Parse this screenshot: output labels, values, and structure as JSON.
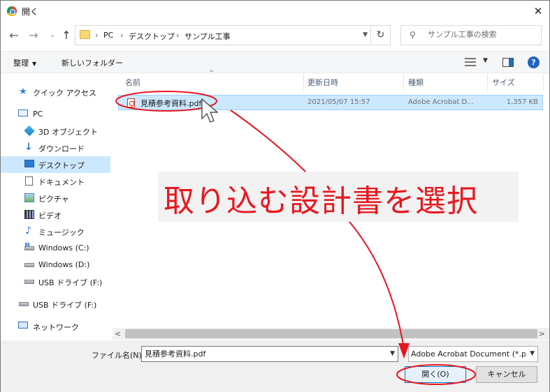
{
  "window": {
    "title": "開く",
    "close_symbol": "✕"
  },
  "nav": {
    "back_symbol": "←",
    "forward_symbol": "→",
    "dropdown_symbol": "⌄",
    "up_symbol": "↑",
    "breadcrumb": [
      "PC",
      "デスクトップ",
      "サンプル工事"
    ],
    "breadcrumb_separator": "›",
    "refresh_symbol": "↻",
    "search_placeholder": "サンプル工事の検索"
  },
  "toolbar": {
    "organize_label": "整理",
    "new_folder_label": "新しいフォルダー",
    "help_symbol": "?"
  },
  "sidebar": {
    "items": [
      {
        "label": "クイック アクセス",
        "icon": "star-icon"
      },
      {
        "label": "PC",
        "icon": "computer-icon"
      },
      {
        "label": "3D オブジェクト",
        "icon": "3d-objects-icon"
      },
      {
        "label": "ダウンロード",
        "icon": "download-icon"
      },
      {
        "label": "デスクトップ",
        "icon": "desktop-icon",
        "selected": true
      },
      {
        "label": "ドキュメント",
        "icon": "document-icon"
      },
      {
        "label": "ピクチャ",
        "icon": "pictures-icon"
      },
      {
        "label": "ビデオ",
        "icon": "video-icon"
      },
      {
        "label": "ミュージック",
        "icon": "music-icon"
      },
      {
        "label": "Windows  (C:)",
        "icon": "drive-icon"
      },
      {
        "label": "Windows (D:)",
        "icon": "drive-icon"
      },
      {
        "label": "USB ドライブ (F:)",
        "icon": "usb-drive-icon"
      },
      {
        "label": "USB ドライブ (F:)",
        "icon": "usb-drive-icon"
      },
      {
        "label": "ネットワーク",
        "icon": "network-icon"
      }
    ]
  },
  "file_list": {
    "columns": [
      "名前",
      "更新日時",
      "種類",
      "サイズ"
    ],
    "sort_symbol": "^",
    "rows": [
      {
        "name": "見積参考資料.pdf",
        "modified": "2021/05/07 15:57",
        "type": "Adobe Acrobat D...",
        "size": "1,357 KB",
        "selected": true
      }
    ]
  },
  "bottom": {
    "filename_label": "ファイル名(N):",
    "filename_value": "見積参考資料.pdf",
    "filetype_value": "Adobe Acrobat Document (*.pc",
    "open_label": "開く(O)",
    "cancel_label": "キャンセル"
  },
  "annotation": {
    "text": "取り込む設計書を選択",
    "color": "#e8171f"
  },
  "colors": {
    "selection": "#cce8ff",
    "accent": "#0078d7",
    "annotation_red": "#e8171f"
  }
}
